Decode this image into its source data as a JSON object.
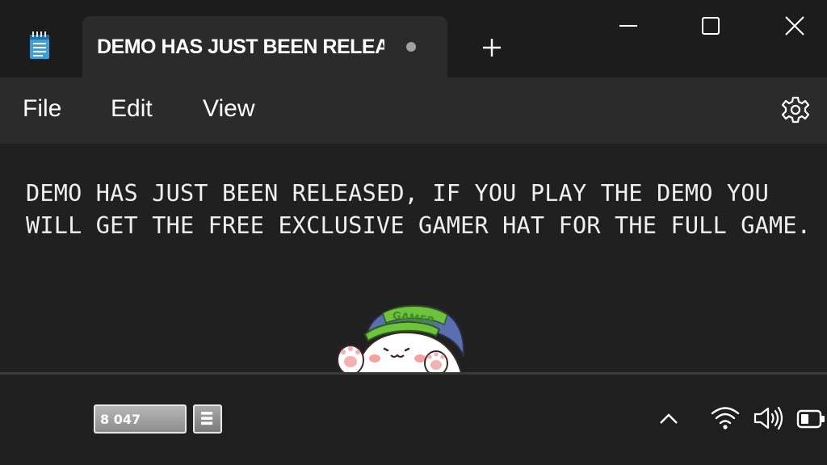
{
  "window": {
    "tab_title": "DEMO HAS JUST BEEN RELEA",
    "tab_unsaved": true
  },
  "menu": {
    "file": "File",
    "edit": "Edit",
    "view": "View"
  },
  "editor": {
    "line1": "DEMO HAS JUST BEEN RELEASED, IF YOU PLAY THE DEMO YOU",
    "line2": "WILL GET THE FREE EXCLUSIVE GAMER HAT FOR THE FULL GAME."
  },
  "mascot": {
    "hat_text": "GAMER",
    "hat_color": "#6fc23c"
  },
  "taskbar": {
    "counter_value": "8 047"
  },
  "icons": {
    "app": "notepad-icon",
    "new_tab": "plus-icon",
    "settings": "gear-icon",
    "tray_expand": "chevron-up-icon",
    "wifi": "wifi-icon",
    "volume": "speaker-icon",
    "battery": "battery-icon"
  },
  "colors": {
    "background": "#202020",
    "tab": "#2b2b2b",
    "text": "#ffffff"
  }
}
